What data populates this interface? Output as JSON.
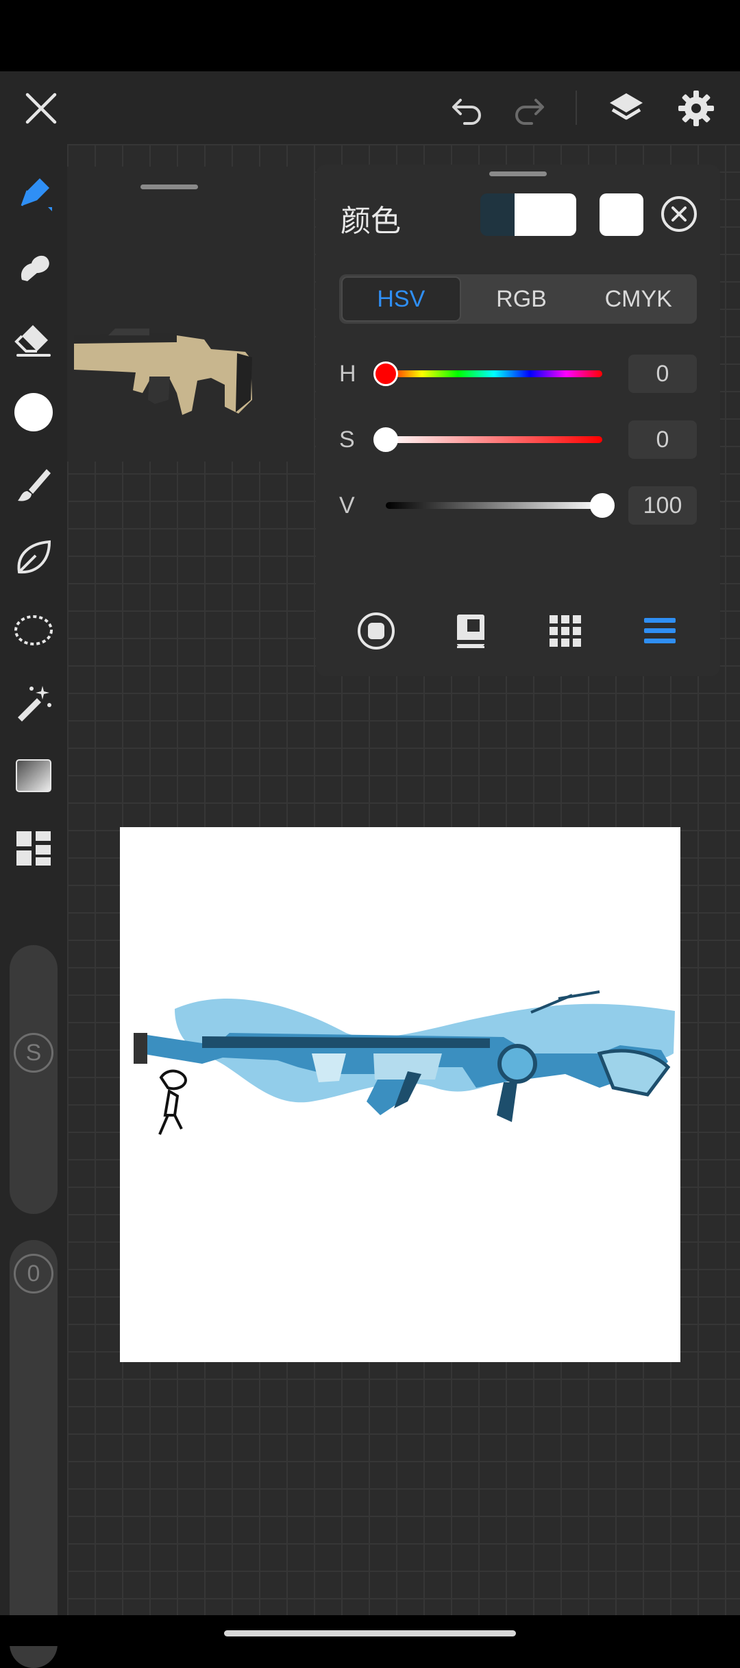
{
  "color_panel": {
    "title": "颜色",
    "tabs": [
      "HSV",
      "RGB",
      "CMYK"
    ],
    "active_tab": "HSV",
    "sliders": [
      {
        "label": "H",
        "value": "0",
        "fraction": 0.0
      },
      {
        "label": "S",
        "value": "0",
        "fraction": 0.0
      },
      {
        "label": "V",
        "value": "100",
        "fraction": 1.0
      }
    ],
    "current_color": "#ffffff",
    "previous_color": "#1f3440",
    "bottom_tabs": [
      "disc-icon",
      "palette-book-icon",
      "grid-swatches-icon",
      "sliders-icon"
    ],
    "active_bottom_tab": "sliders-icon"
  },
  "toolbar": {
    "tools": [
      "brush-icon",
      "smudge-icon",
      "eraser-icon",
      "color-dot-icon",
      "paint-brush-icon",
      "leaf-icon",
      "lasso-icon",
      "magic-wand-icon",
      "gradient-icon",
      "grid-tiles-icon"
    ],
    "size_badge": "S",
    "opacity_badge": "0"
  },
  "accent": "#2f8ff5"
}
